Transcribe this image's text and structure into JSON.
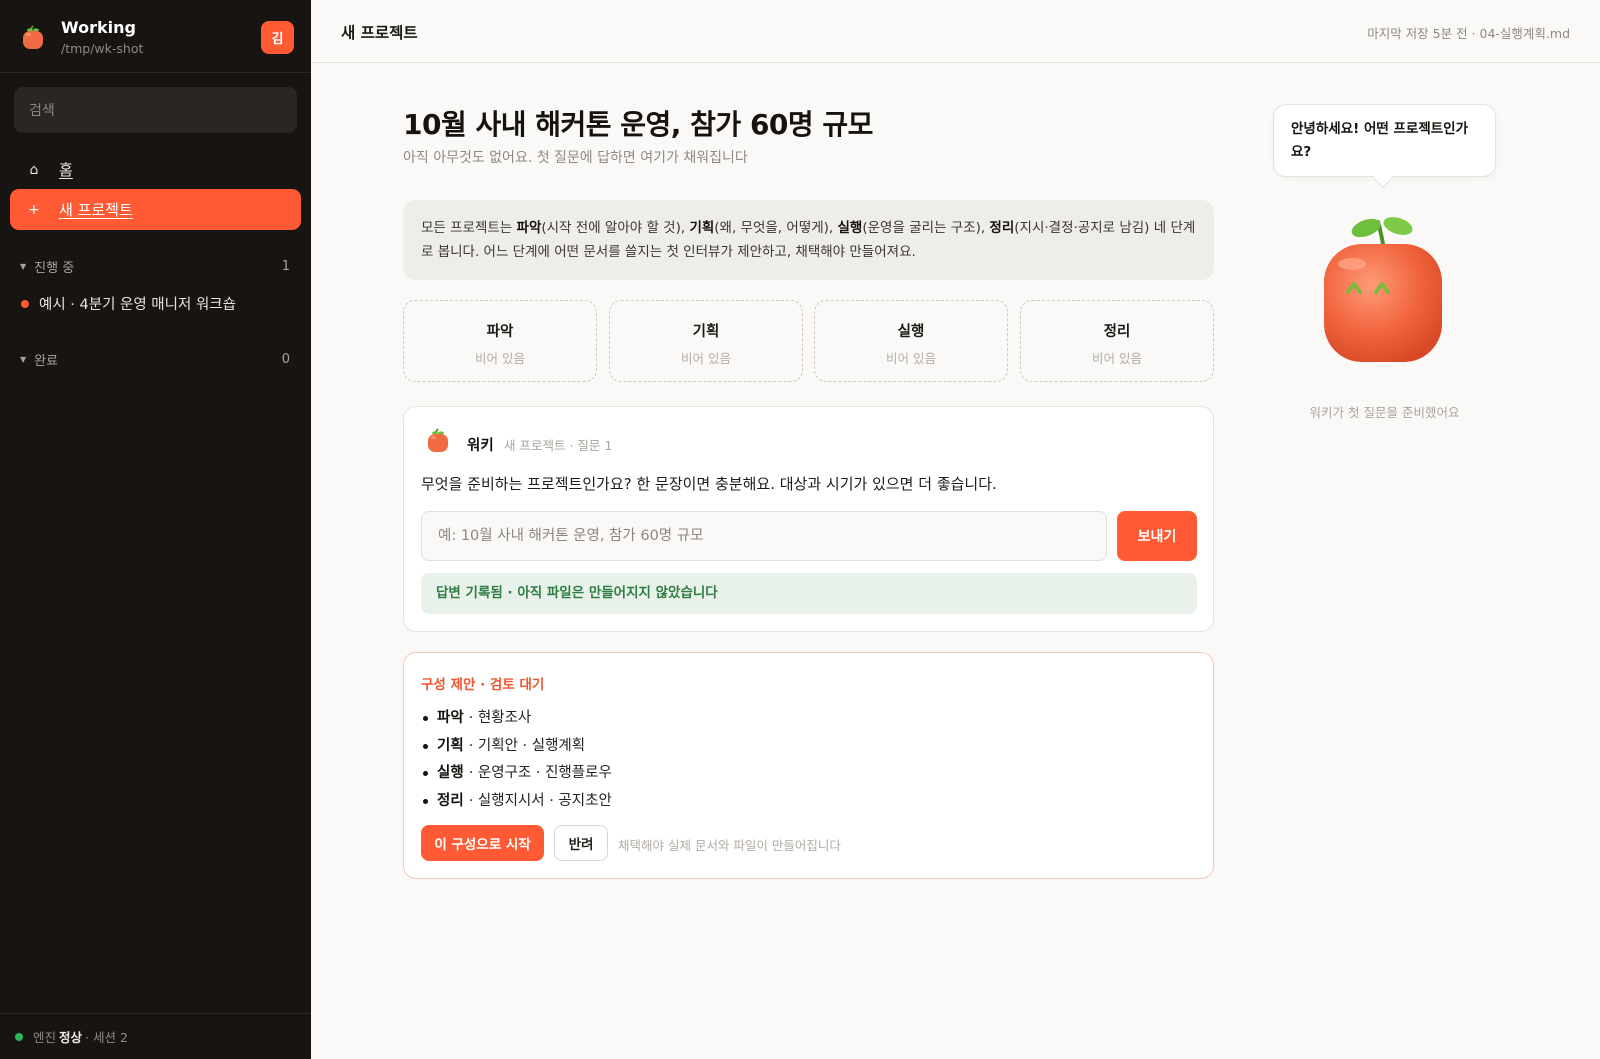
{
  "sidebar": {
    "app_title": "Working",
    "path": "/tmp/wk-shot",
    "avatar_initial": "김",
    "search_placeholder": "검색",
    "nav": [
      {
        "icon": "home-icon",
        "glyph": "⌂",
        "label": "홈"
      },
      {
        "icon": "plus-icon",
        "glyph": "+",
        "label": "새 프로젝트"
      }
    ],
    "groups": {
      "active": {
        "label": "진행 중",
        "count": "1",
        "items": [
          "예시 · 4분기 운영 매니저 워크숍"
        ]
      },
      "done": {
        "label": "완료",
        "count": "0"
      }
    },
    "footer": {
      "prefix": "엔진",
      "status": "정상",
      "suffix": "· 세션 2"
    }
  },
  "topbar": {
    "title": "새 프로젝트",
    "status": "마지막 저장 5분 전 · 04-실행계획.md"
  },
  "main": {
    "heading": "10월 사내 해커톤 운영, 참가 60명 규모",
    "subheading": "아직 아무것도 없어요. 첫 질문에 답하면 여기가 채워집니다",
    "info": {
      "t1": "모든 프로젝트는 ",
      "b1": "파악",
      "t2": "(시작 전에 알아야 할 것), ",
      "b2": "기획",
      "t3": "(왜, 무엇을, 어떻게), ",
      "b3": "실행",
      "t4": "(운영을 굴리는 구조), ",
      "b4": "정리",
      "t5": "(지시·결정·공지로 남김) 네 단계로 봅니다. 어느 단계에 어떤 문서를 쓸지는 첫 인터뷰가 제안하고, 채택해야 만들어져요."
    },
    "stages": [
      {
        "name": "파악",
        "state": "비어 있음"
      },
      {
        "name": "기획",
        "state": "비어 있음"
      },
      {
        "name": "실행",
        "state": "비어 있음"
      },
      {
        "name": "정리",
        "state": "비어 있음"
      }
    ],
    "question_card": {
      "assistant_name": "워키",
      "meta": "새 프로젝트 · 질문 1",
      "question": "무엇을 준비하는 프로젝트인가요? 한 문장이면 충분해요. 대상과 시기가 있으면 더 좋습니다.",
      "input_value": "",
      "input_placeholder": "예: 10월 사내 해커톤 운영, 참가 60명 규모",
      "send_label": "보내기",
      "note": "답변 기록됨 · 아직 파일은 만들어지지 않았습니다"
    },
    "proposal_card": {
      "title": "구성 제안 · 검토 대기",
      "items": [
        {
          "stage": "파악",
          "docs": "· 현황조사"
        },
        {
          "stage": "기획",
          "docs": "· 기획안 · 실행계획"
        },
        {
          "stage": "실행",
          "docs": "· 운영구조 · 진행플로우"
        },
        {
          "stage": "정리",
          "docs": "· 실행지시서 · 공지초안"
        }
      ],
      "start_label": "이 구성으로 시작",
      "reject_label": "반려",
      "hint": "채택해야 실제 문서와 파일이 만들어집니다"
    }
  },
  "mascot": {
    "bubble": "안녕하세요! 어떤 프로젝트인가요?",
    "caption": "워키가 첫 질문을 준비했어요"
  },
  "colors": {
    "accent": "#ff5a33",
    "sidebar_bg": "#171411",
    "success": "#2f7d45",
    "engine_ok": "#2fb559"
  }
}
